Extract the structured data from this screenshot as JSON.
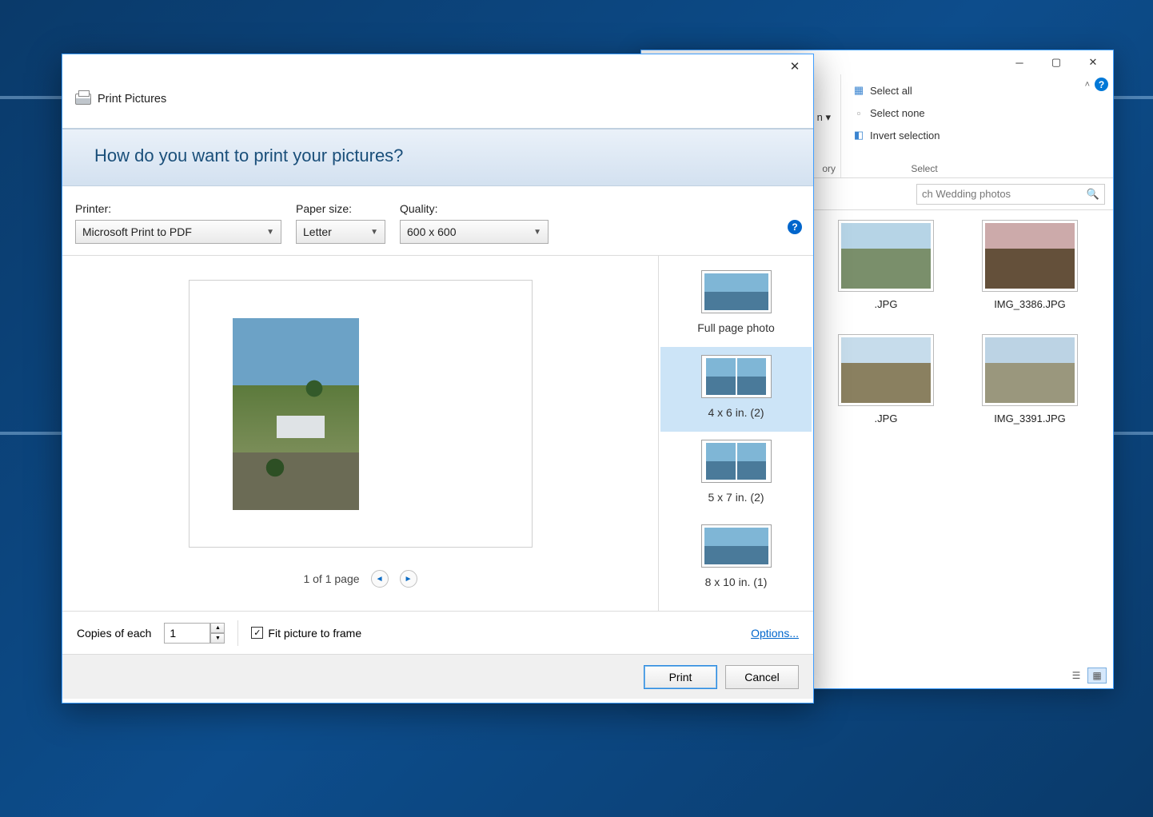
{
  "explorer": {
    "partial_text": "n ▾",
    "partial_caption": "ory",
    "ribbon": {
      "select_all": "Select all",
      "select_none": "Select none",
      "invert": "Invert selection",
      "caption": "Select"
    },
    "search": {
      "placeholder": "ch Wedding photos"
    },
    "files": [
      {
        "name": ".JPG"
      },
      {
        "name": "IMG_3386.JPG"
      },
      {
        "name": ".JPG"
      },
      {
        "name": "IMG_3391.JPG"
      }
    ]
  },
  "print_dialog": {
    "title": "Print Pictures",
    "heading": "How do you want to print your pictures?",
    "labels": {
      "printer": "Printer:",
      "paper": "Paper size:",
      "quality": "Quality:"
    },
    "values": {
      "printer": "Microsoft Print to PDF",
      "paper": "Letter",
      "quality": "600 x 600"
    },
    "pager": "1 of 1 page",
    "layouts": [
      {
        "label": "Full page photo",
        "panes": 1
      },
      {
        "label": "4 x 6 in. (2)",
        "panes": 2,
        "selected": true
      },
      {
        "label": "5 x 7 in. (2)",
        "panes": 2
      },
      {
        "label": "8 x 10 in. (1)",
        "panes": 1
      }
    ],
    "copies_label": "Copies of each",
    "copies_value": "1",
    "fit_label": "Fit picture to frame",
    "fit_checked": true,
    "options_link": "Options...",
    "buttons": {
      "print": "Print",
      "cancel": "Cancel"
    }
  }
}
